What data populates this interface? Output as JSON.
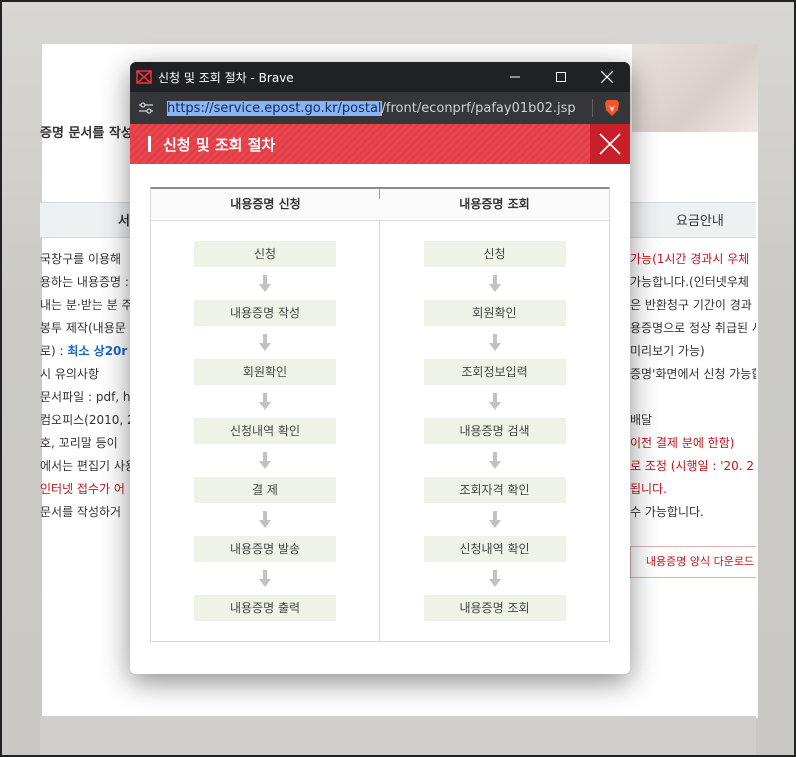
{
  "background": {
    "header_title": "증명 문서를 작성",
    "tab_left": "서",
    "tab_right": "요금안내",
    "left_lines": [
      "국창구를 이용해 ",
      "용하는 내용증명 :",
      "내는 분·받는 분 주",
      "봉투 제작(내용문",
      "로) : ",
      "시 유의사항",
      "문서파일 : pdf, h",
      "컴오피스(2010, 2",
      "호, 꼬리말 등이 ",
      "에서는 편집기 사용",
      "인터넷 접수가 어",
      "문서를 작성하거"
    ],
    "left_blue": "최소 상20r",
    "right_lines": [
      "가능(1시간 경과시 우체",
      "가능합니다.(인터넷우체",
      "은 반환청구 기간이 경과",
      "용증명으로 정상 취급된 사",
      "미리보기 가능)",
      "증명'화면에서 신청 가능합",
      "",
      "배달",
      "이전 결제 분에 한함)",
      "로 조정 (시행일 : '20. 2",
      "됩니다.",
      "수 가능합니다."
    ],
    "download_label": "내용증명 양식 다운로드"
  },
  "window": {
    "title": "신청 및 조회 절차 - Brave",
    "url_selected": "https://service.epost.go.kr/postal",
    "url_rest": "/front/econprf/pafay01b02.jsp"
  },
  "popup": {
    "title": "신청 및 조회 절차",
    "columns": [
      {
        "header": "내용증명 신청",
        "steps": [
          "신청",
          "내용증명 작성",
          "회원확인",
          "신청내역 확인",
          "결 제",
          "내용증명 발송",
          "내용증명 출력"
        ]
      },
      {
        "header": "내용증명 조회",
        "steps": [
          "신청",
          "회원확인",
          "조회정보입력",
          "내용증명 검색",
          "조회자격 확인",
          "신청내역 확인",
          "내용증명 조회"
        ]
      }
    ]
  },
  "colors": {
    "accent_red": "#e8464f",
    "step_bg": "#eff2e6"
  }
}
